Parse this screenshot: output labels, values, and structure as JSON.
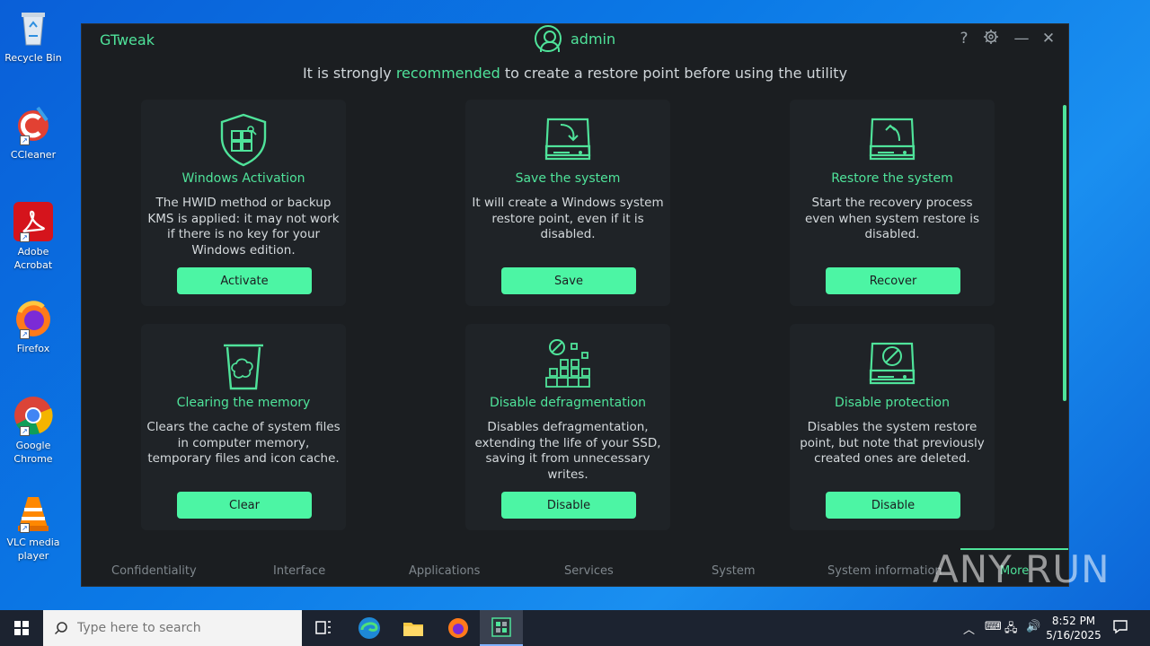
{
  "desktop": {
    "icons": [
      {
        "label": "Recycle Bin"
      },
      {
        "label": "CCleaner"
      },
      {
        "label": "Adobe Acrobat"
      },
      {
        "label": "Firefox"
      },
      {
        "label": "Google Chrome"
      },
      {
        "label": "VLC media player"
      }
    ]
  },
  "app": {
    "title": "GTweak",
    "user": "admin",
    "banner_pre": "It is strongly ",
    "banner_highlight": "recommended",
    "banner_post": " to create a restore point before using the utility",
    "accent": "#4fe39a",
    "cards": [
      {
        "title": "Windows Activation",
        "desc": "The HWID method or backup KMS is applied: it may not work if there is no key for your Windows edition.",
        "button": "Activate",
        "icon": "shield-windows-icon"
      },
      {
        "title": "Save the system",
        "desc": "It will create a Windows system restore point, even if it is disabled.",
        "button": "Save",
        "icon": "drive-save-icon"
      },
      {
        "title": "Restore the system",
        "desc": "Start the recovery process even when system restore is disabled.",
        "button": "Recover",
        "icon": "drive-restore-icon"
      },
      {
        "title": "Clearing the memory",
        "desc": "Clears the cache of system files in computer memory, temporary files and icon cache.",
        "button": "Clear",
        "icon": "trash-icon"
      },
      {
        "title": "Disable defragmentation",
        "desc": "Disables defragmentation, extending the life of your SSD, saving it from unnecessary writes.",
        "button": "Disable",
        "icon": "blocks-disable-icon"
      },
      {
        "title": "Disable protection",
        "desc": "Disables the system restore point, but note that previously created ones are deleted.",
        "button": "Disable",
        "icon": "drive-disable-icon"
      }
    ],
    "nav": [
      "Confidentiality",
      "Interface",
      "Applications",
      "Services",
      "System",
      "System information",
      "More"
    ]
  },
  "watermark": "ANY RUN",
  "taskbar": {
    "search_placeholder": "Type here to search",
    "time": "8:52 PM",
    "date": "5/16/2025"
  }
}
